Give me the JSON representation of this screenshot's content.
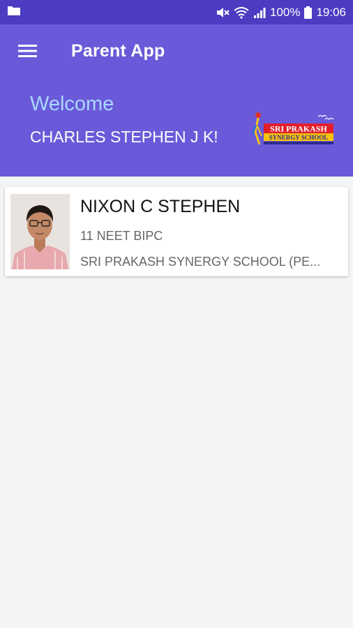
{
  "status_bar": {
    "battery": "100%",
    "time": "19:06",
    "icons": [
      "folder-icon",
      "mute-icon",
      "wifi-icon",
      "signal-icon",
      "battery-icon"
    ]
  },
  "header": {
    "title": "Parent App",
    "welcome": "Welcome",
    "parent_name": "CHARLES STEPHEN J K!",
    "menu_icon": "hamburger-menu-icon",
    "logo": {
      "line1": "SRI PRAKASH",
      "line2": "SYNERGY SCHOOL"
    }
  },
  "students": [
    {
      "name": "NIXON C STEPHEN",
      "class": "11 NEET BIPC",
      "school": "SRI PRAKASH SYNERGY SCHOOL (PE..."
    }
  ],
  "colors": {
    "status_bar": "#4b3cc2",
    "header": "#6a5ad9",
    "welcome_text": "#a9d7ff",
    "background": "#f3f4f6"
  }
}
